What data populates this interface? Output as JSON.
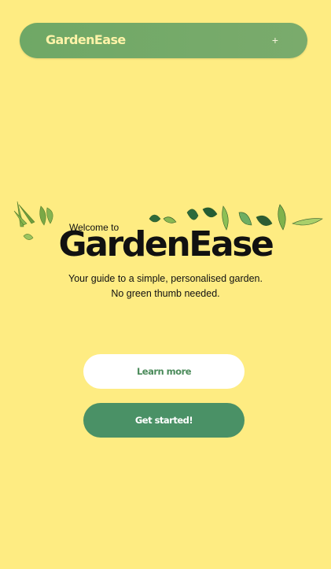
{
  "header": {
    "brand": "GardenEase",
    "menu_icon": "plus-icon",
    "menu_glyph": "+"
  },
  "hero": {
    "welcome": "Welcome to",
    "title": "GardenEase",
    "subtitle_line1": "Your guide to a simple, personalised garden.",
    "subtitle_line2": "No green thumb needed."
  },
  "actions": {
    "learn_more": "Learn more",
    "get_started": "Get started!"
  },
  "colors": {
    "background": "#feec82",
    "header_green": "#72a86a",
    "brand_text": "#fff3a8",
    "primary_button": "#4a9166",
    "secondary_button_text": "#4b8b5b"
  }
}
